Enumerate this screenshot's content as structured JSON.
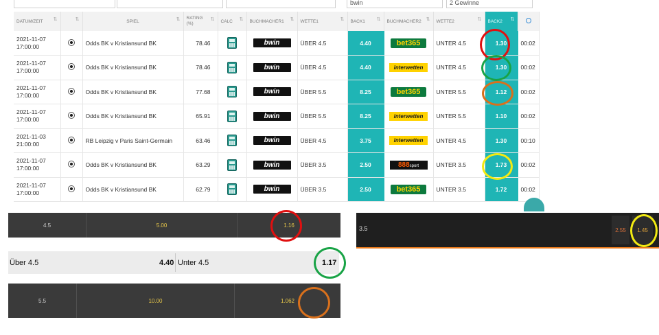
{
  "filters": {
    "bookmaker_value": "bwin",
    "outcome_value": "2 Gewinne"
  },
  "table": {
    "headers": {
      "datetime": "DATUM/ZEIT",
      "game": "SPIEL",
      "rating": "RATING (%)",
      "calc": "CALC",
      "bookmaker1": "BUCHMACHER1",
      "bet1": "WETTE1",
      "back1": "BACK1",
      "bookmaker2": "BUCHMACHER2",
      "bet2": "WETTE2",
      "back2": "BACK2",
      "sort_glyph": "⇅"
    },
    "rows": [
      {
        "date": "2021-11-07",
        "time": "17:00:00",
        "game": "Odds BK v Kristiansund BK",
        "rating": "78.46",
        "bookmaker1": "bwin",
        "bet1": "ÜBER 4.5",
        "back1": "4.40",
        "bookmaker2": "bet365",
        "bet2": "UNTER 4.5",
        "back2": "1.30",
        "elapsed": "00:02"
      },
      {
        "date": "2021-11-07",
        "time": "17:00:00",
        "game": "Odds BK v Kristiansund BK",
        "rating": "78.46",
        "bookmaker1": "bwin",
        "bet1": "ÜBER 4.5",
        "back1": "4.40",
        "bookmaker2": "interwetten",
        "bet2": "UNTER 4.5",
        "back2": "1.30",
        "elapsed": "00:02"
      },
      {
        "date": "2021-11-07",
        "time": "17:00:00",
        "game": "Odds BK v Kristiansund BK",
        "rating": "77.68",
        "bookmaker1": "bwin",
        "bet1": "ÜBER 5.5",
        "back1": "8.25",
        "bookmaker2": "bet365",
        "bet2": "UNTER 5.5",
        "back2": "1.12",
        "elapsed": "00:02"
      },
      {
        "date": "2021-11-07",
        "time": "17:00:00",
        "game": "Odds BK v Kristiansund BK",
        "rating": "65.91",
        "bookmaker1": "bwin",
        "bet1": "ÜBER 5.5",
        "back1": "8.25",
        "bookmaker2": "interwetten",
        "bet2": "UNTER 5.5",
        "back2": "1.10",
        "elapsed": "00:02"
      },
      {
        "date": "2021-11-03",
        "time": "21:00:00",
        "game": "RB Leipzig v Paris Saint-Germain",
        "rating": "63.46",
        "bookmaker1": "bwin",
        "bet1": "ÜBER 4.5",
        "back1": "3.75",
        "bookmaker2": "interwetten",
        "bet2": "UNTER 4.5",
        "back2": "1.30",
        "elapsed": "00:10"
      },
      {
        "date": "2021-11-07",
        "time": "17:00:00",
        "game": "Odds BK v Kristiansund BK",
        "rating": "63.29",
        "bookmaker1": "bwin",
        "bet1": "ÜBER 3.5",
        "back1": "2.50",
        "bookmaker2": "888sport",
        "bet2": "UNTER 3.5",
        "back2": "1.73",
        "elapsed": "00:02"
      },
      {
        "date": "2021-11-07",
        "time": "17:00:00",
        "game": "Odds BK v Kristiansund BK",
        "rating": "62.79",
        "bookmaker1": "bwin",
        "bet1": "ÜBER 3.5",
        "back1": "2.50",
        "bookmaker2": "bet365",
        "bet2": "UNTER 3.5",
        "back2": "1.72",
        "elapsed": "00:02"
      }
    ]
  },
  "logos": {
    "bwin": "bwin",
    "bet365": "bet365",
    "interwetten": "interwetten",
    "888_main": "888",
    "888_sub": "sport"
  },
  "comparisons": {
    "panel1": {
      "line": "4.5",
      "over": "5.00",
      "under": "1.16"
    },
    "panel2": {
      "over_label": "Über 4.5",
      "over_odds": "4.40",
      "under_label": "Unter 4.5",
      "under_odds": "1.17"
    },
    "panel3": {
      "line": "5.5",
      "over": "10.00",
      "under": "1.062"
    },
    "panel4": {
      "line": "3.5",
      "over": "2.55",
      "under": "1.45"
    }
  },
  "colors": {
    "teal": "#1fb5b5",
    "red": "#e01010",
    "green": "#19a346",
    "orange": "#d8701c",
    "yellow": "#f2ea12"
  }
}
